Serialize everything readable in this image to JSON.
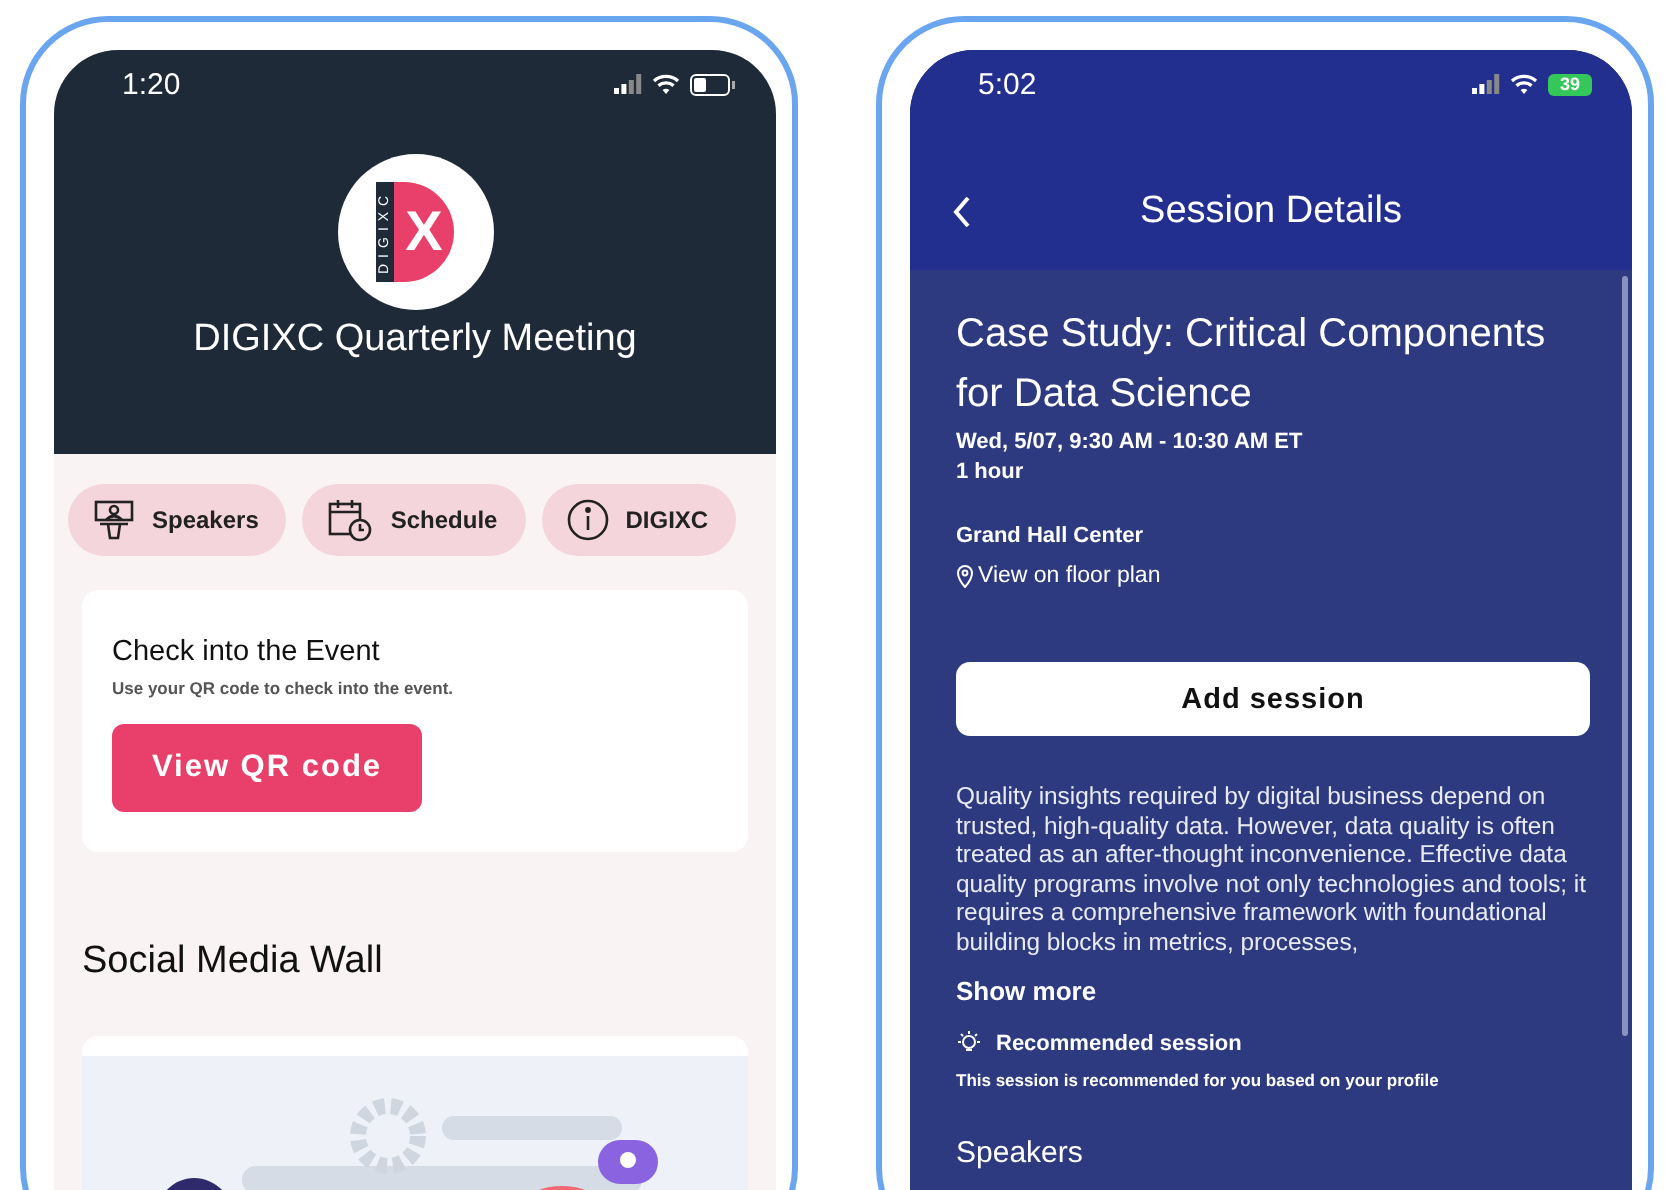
{
  "event_app": {
    "status_bar": {
      "time": "1:20"
    },
    "logo": {
      "side_text": "DIGIXC",
      "letter": "X"
    },
    "title": "DIGIXC Quarterly Meeting",
    "tabs": [
      {
        "label": "Speakers",
        "kind": "speakers"
      },
      {
        "label": "Schedule",
        "kind": "schedule"
      },
      {
        "label": "DIGIXC",
        "kind": "info"
      }
    ],
    "checkin_card": {
      "title": "Check into the Event",
      "subtitle": "Use your QR code to check into the event.",
      "button": "View QR code"
    },
    "section_title": "Social Media Wall"
  },
  "session_app": {
    "status_bar": {
      "time": "5:02",
      "battery": "39"
    },
    "nav": {
      "title": "Session Details"
    },
    "session_title": "Case Study: Critical Components for Data Science",
    "datetime": "Wed, 5/07, 9:30 AM - 10:30 AM ET",
    "duration": "1 hour",
    "location": "Grand Hall Center",
    "floor_plan_link": "View on floor plan",
    "add_button": "Add session",
    "description": "Quality insights required by digital business depend on trusted, high-quality data. However, data quality is often treated as an after-thought inconvenience. Effective data quality programs involve not only technologies and tools; it requires a comprehensive framework with foundational building blocks in metrics, processes,",
    "show_more": "Show more",
    "recommendation": {
      "title": "Recommended session",
      "note": "This session is recommended for you based on your profile"
    },
    "speakers_heading": "Speakers"
  }
}
